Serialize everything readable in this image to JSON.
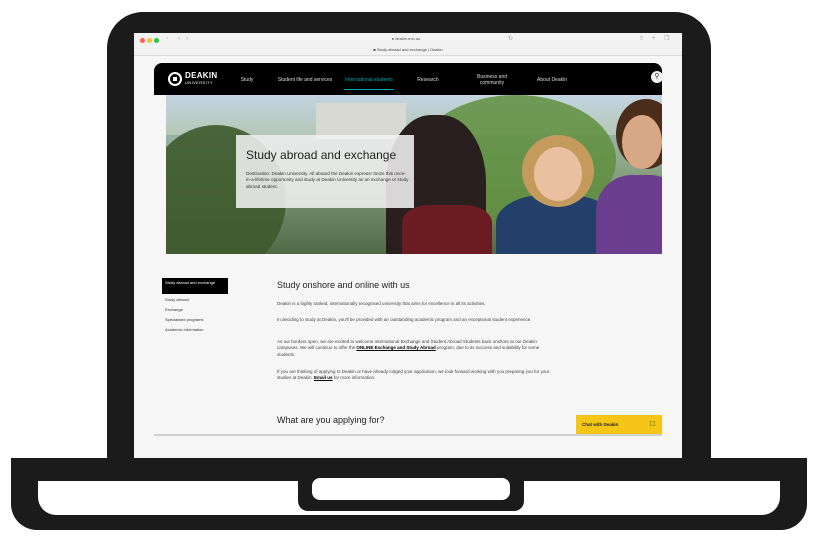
{
  "browser": {
    "url": "deakin.edu.au",
    "tab_title": "Study abroad and exchange | Deakin",
    "icons": [
      "back-icon",
      "forward-icon",
      "sidebar-icon",
      "reload-icon",
      "share-icon",
      "new-tab-icon",
      "tabs-icon"
    ]
  },
  "site": {
    "logo_name": "DEAKIN",
    "logo_sub": "UNIVERSITY",
    "nav": [
      {
        "label": "Study"
      },
      {
        "label": "Student life and services"
      },
      {
        "label": "International students",
        "active": true
      },
      {
        "label": "Research"
      },
      {
        "label": "Business and community"
      },
      {
        "label": "About Deakin"
      }
    ],
    "accent": "#00a4b7"
  },
  "hero": {
    "title": "Study abroad and exchange",
    "description": "Destination: Deakin University. All aboard the Deakin express! Seize this once-in-a-lifetime opportunity and study at Deakin University as an exchange or study abroad student."
  },
  "sidebar": {
    "items": [
      {
        "label": "Study abroad and exchange",
        "active": true
      },
      {
        "label": "Study abroad"
      },
      {
        "label": "Exchange"
      },
      {
        "label": "Specialised programs"
      },
      {
        "label": "Academic information"
      }
    ]
  },
  "main": {
    "heading": "Study onshore and online with us",
    "p1": "Deakin is a highly ranked, internationally recognised university that aims for excellence in all its activities.",
    "p2": "In deciding to study at Deakin, you'll be provided with an outstanding academic program and an exceptional student experience.",
    "p3_a": "As our borders open, we are excited to welcome International Exchange and Student Abroad Students back onshore at our Deakin campuses. We will continue to offer the ",
    "p3_link": "ONLINE Exchange and Study Abroad",
    "p3_b": " program, due to its success and suitability for some students.",
    "p4_a": "If you are thinking of applying to Deakin or have already lodged your application, we look forward working with you preparing you for your studies at Deakin. ",
    "p4_link": "Email us",
    "p4_b": " for more information.",
    "subheading": "What are you applying for?"
  },
  "chat": {
    "label": "Chat with Deakin",
    "color": "#f5c518"
  }
}
